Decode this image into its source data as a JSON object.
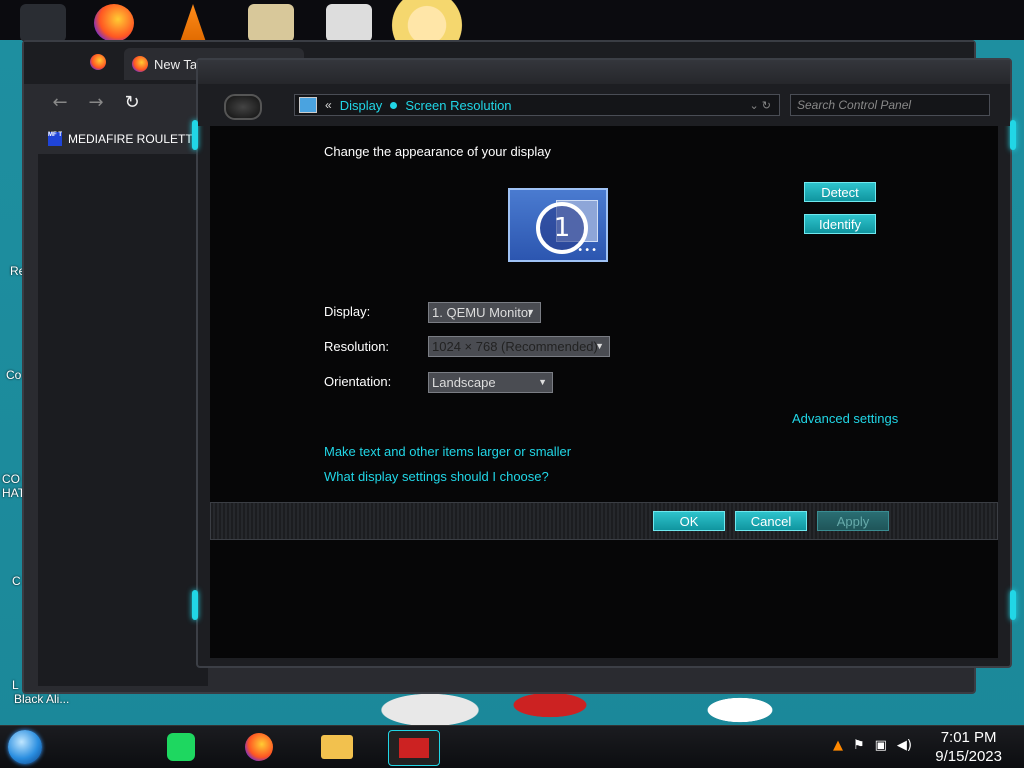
{
  "desktop": {
    "labels": [
      "Re",
      "Co",
      "CO",
      "HAT",
      "C",
      "L",
      "Black Ali..."
    ]
  },
  "browser": {
    "tab_label": "New Tab",
    "bookmark_label": "MEDIAFIRE ROULETTER",
    "bookmark_icon_text": "MF T",
    "back": "←",
    "forward": "→",
    "reload": "↻"
  },
  "control_panel": {
    "breadcrumb_prefix": "«",
    "breadcrumb": [
      "Display",
      "Screen Resolution"
    ],
    "search_placeholder": "Search Control Panel",
    "heading": "Change the appearance of your display",
    "monitor_number": "1",
    "detect_label": "Detect",
    "identify_label": "Identify",
    "display_label": "Display:",
    "display_value": "1. QEMU Monitor",
    "resolution_label": "Resolution:",
    "resolution_value": "1024 × 768 (Recommended)",
    "orientation_label": "Orientation:",
    "orientation_value": "Landscape",
    "advanced_link": "Advanced settings",
    "text_size_link": "Make text and other items larger or smaller",
    "help_link": "What display settings should I choose?",
    "ok_label": "OK",
    "cancel_label": "Cancel",
    "apply_label": "Apply"
  },
  "taskbar": {
    "time": "7:01 PM",
    "date": "9/15/2023"
  },
  "colors": {
    "accent": "#21d6e6",
    "window_bg": "#060607",
    "button": "#10959f"
  }
}
